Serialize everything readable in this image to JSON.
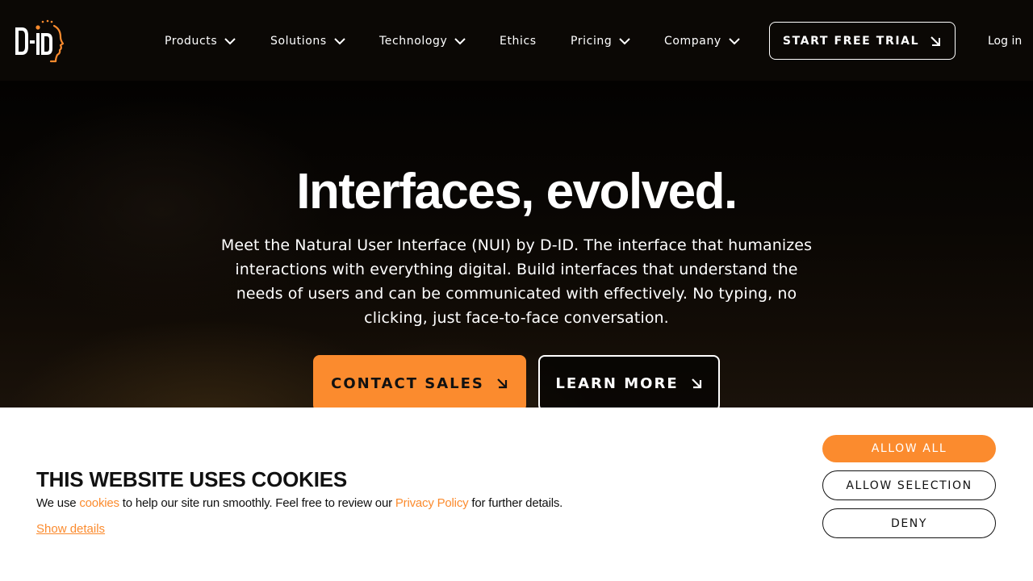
{
  "brand": {
    "logo_text": "D-iD",
    "accent_color": "#fb8b2e"
  },
  "nav": {
    "items": [
      {
        "label": "Products",
        "has_dropdown": true
      },
      {
        "label": "Solutions",
        "has_dropdown": true
      },
      {
        "label": "Technology",
        "has_dropdown": true
      },
      {
        "label": "Ethics",
        "has_dropdown": false
      },
      {
        "label": "Pricing",
        "has_dropdown": true
      },
      {
        "label": "Company",
        "has_dropdown": true
      }
    ],
    "cta_label": "START FREE TRIAL",
    "cta_icon": "arrow-down-right-icon",
    "login_label": "Log in"
  },
  "hero": {
    "title": "Interfaces, evolved.",
    "subtitle": "Meet the Natural User Interface (NUI) by D-ID. The interface that humanizes interactions with everything digital. Build interfaces that understand the needs of users and can be communicated with effectively. No typing, no clicking, just face-to-face conversation.",
    "primary_button": "CONTACT SALES",
    "secondary_button": "LEARN MORE",
    "button_icon": "arrow-down-right-icon"
  },
  "cookie_banner": {
    "title": "THIS WEBSITE USES COOKIES",
    "text_before": "We use ",
    "cookies_link": "cookies",
    "text_middle": " to help our site run smoothly. Feel free to review our ",
    "privacy_link": "Privacy Policy",
    "text_after": " for further details.",
    "show_details": "Show details",
    "allow_all": "ALLOW ALL",
    "allow_selection": "ALLOW SELECTION",
    "deny": "DENY"
  }
}
